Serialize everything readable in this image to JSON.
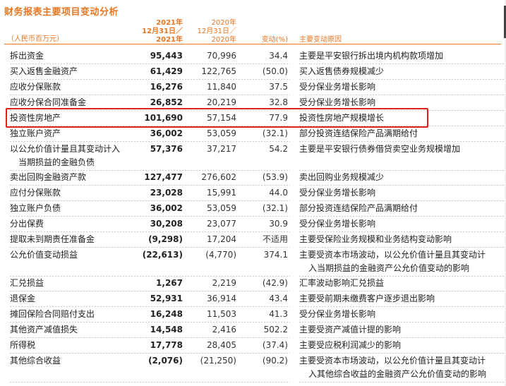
{
  "title": "财务报表主要项目变动分析",
  "header": {
    "unit": "（人民币百万元）",
    "col1": [
      "2021年",
      "12月31日／",
      "2021年"
    ],
    "col2": [
      "2020年",
      "12月31日／",
      "2020年"
    ],
    "change": "变动(%)",
    "reason": "主要变动原因"
  },
  "colors": {
    "accent": "#e87722",
    "highlight": "#e0201a"
  },
  "rows": [
    {
      "item": "拆出资金",
      "v2021": "95,443",
      "v2020": "70,996",
      "change": "34.4",
      "reason": "主要是平安银行拆出境内机构款项增加"
    },
    {
      "item": "买入返售金融资产",
      "v2021": "61,429",
      "v2020": "122,765",
      "change": "(50.0)",
      "reason": "买入返售债券规模减少"
    },
    {
      "item": "应收分保账款",
      "v2021": "16,276",
      "v2020": "11,840",
      "change": "37.5",
      "reason": "受分保业务增长影响"
    },
    {
      "item": "应收分保合同准备金",
      "v2021": "26,852",
      "v2020": "20,219",
      "change": "32.8",
      "reason": "受分保业务增长影响"
    },
    {
      "item": "投资性房地产",
      "v2021": "101,690",
      "v2020": "57,154",
      "change": "77.9",
      "reason": "投资性房地产规模增长"
    },
    {
      "item": "独立账户资产",
      "v2021": "36,002",
      "v2020": "53,059",
      "change": "(32.1)",
      "reason": "部分投资连结保险产品满期给付"
    },
    {
      "item": "以公允价值计量且其变动计入",
      "item2": "当期损益的金融负债",
      "v2021": "57,376",
      "v2020": "37,217",
      "change": "54.2",
      "reason": "主要是平安银行债券借贷卖空业务规模增加"
    },
    {
      "item": "卖出回购金融资产款",
      "v2021": "127,477",
      "v2020": "276,602",
      "change": "(53.9)",
      "reason": "卖出回购业务规模减少"
    },
    {
      "item": "应付分保账款",
      "v2021": "23,028",
      "v2020": "15,991",
      "change": "44.0",
      "reason": "受分保业务增长影响"
    },
    {
      "item": "独立账户负债",
      "v2021": "36,002",
      "v2020": "53,059",
      "change": "(32.1)",
      "reason": "部分投资连结保险产品满期给付"
    },
    {
      "item": "分出保费",
      "v2021": "30,208",
      "v2020": "23,077",
      "change": "30.9",
      "reason": "受分保业务增长影响"
    },
    {
      "item": "提取未到期责任准备金",
      "v2021": "(9,298)",
      "v2020": "17,204",
      "change": "不适用",
      "reason": "主要受保险业务规模和业务结构变动影响"
    },
    {
      "item": "公允价值变动损益",
      "v2021": "(22,613)",
      "v2020": "(4,770)",
      "change": "374.1",
      "reason": "主要受资本市场波动，以公允价值计量且其变动计",
      "reason2": "入当期损益的金融资产公允价值变动的影响"
    },
    {
      "item": "汇兑损益",
      "v2021": "1,267",
      "v2020": "2,219",
      "change": "(42.9)",
      "reason": "汇率波动影响汇兑损益"
    },
    {
      "item": "退保金",
      "v2021": "52,931",
      "v2020": "36,914",
      "change": "43.4",
      "reason": "主要受前期未缴费客户逐步退出影响"
    },
    {
      "item": "摊回保险合同赔付支出",
      "v2021": "16,248",
      "v2020": "11,503",
      "change": "41.3",
      "reason": "受分保业务增长影响"
    },
    {
      "item": "其他资产减值损失",
      "v2021": "14,548",
      "v2020": "2,416",
      "change": "502.2",
      "reason": "主要受资产减值计提的影响"
    },
    {
      "item": "所得税",
      "v2021": "17,778",
      "v2020": "28,405",
      "change": "(37.4)",
      "reason": "主要受应税利润减少的影响"
    },
    {
      "item": "其他综合收益",
      "v2021": "(2,076)",
      "v2020": "(21,250)",
      "change": "(90.2)",
      "reason": "主要受资本市场波动，以公允价值计量且其变动计",
      "reason2": "入其他综合收益的金融资产公允价值变动的影响"
    }
  ]
}
